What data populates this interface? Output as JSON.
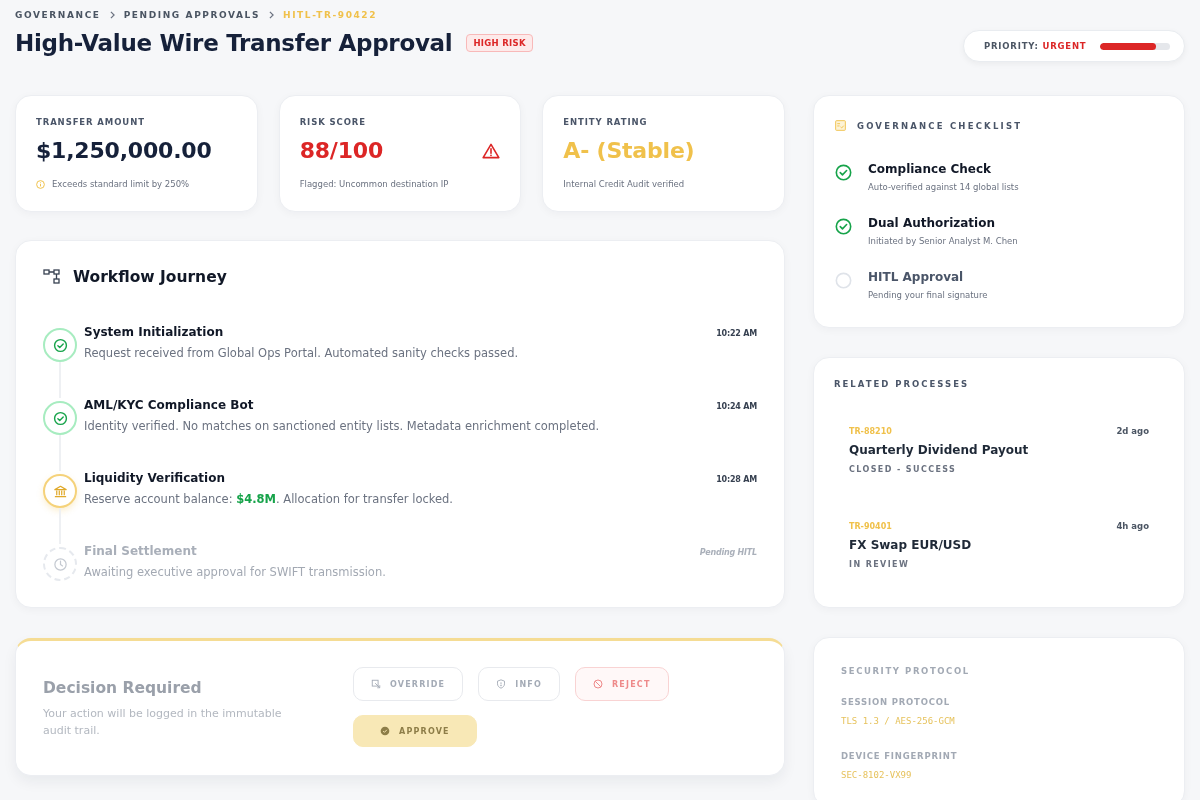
{
  "breadcrumbs": [
    {
      "label": "GOVERNANCE",
      "current": false
    },
    {
      "label": "PENDING APPROVALS",
      "current": false
    },
    {
      "label": "HITL-TR-90422",
      "current": true
    }
  ],
  "title": "High-Value Wire Transfer Approval",
  "risk_badge": "HIGH RISK",
  "priority": {
    "label": "PRIORITY:",
    "value": "URGENT",
    "level": 0.8
  },
  "metrics": [
    {
      "kind": "amount",
      "label": "TRANSFER AMOUNT",
      "value": "$1,250,000.00",
      "color": "#16213a",
      "note": "Exceeds standard limit by 250%"
    },
    {
      "kind": "risk",
      "label": "RISK SCORE",
      "value": "88/100",
      "color": "#dc2626",
      "note": "Flagged: Uncommon destination IP"
    },
    {
      "kind": "rating",
      "label": "ENTITY RATING",
      "value": "A- (Stable)",
      "color": "#f0c14b",
      "note": "Internal Credit Audit verified"
    }
  ],
  "workflow": {
    "title": "Workflow Journey",
    "steps": [
      {
        "kind": "done",
        "title": "System Initialization",
        "detail": "Request received from Global Ops Portal. Automated sanity checks passed.",
        "time": "10:22 AM"
      },
      {
        "kind": "done",
        "title": "AML/KYC Compliance Bot",
        "detail": "Identity verified. No matches on sanctioned entity lists. Metadata enrichment completed.",
        "time": "10:24 AM"
      },
      {
        "kind": "active",
        "title": "Liquidity Verification",
        "detail": "Reserve account balance: **$4.8M**. Allocation for transfer locked.",
        "time": "10:28 AM"
      },
      {
        "kind": "pending",
        "title": "Final Settlement",
        "detail": "Awaiting executive approval for SWIFT transmission.",
        "time": "Pending HITL"
      }
    ]
  },
  "decision": {
    "title": "Decision Required",
    "text": "Your action will be logged in the immutable audit trail.",
    "actions": [
      {
        "label": "OVERRIDE",
        "kind": "override"
      },
      {
        "label": "INFO",
        "kind": "info"
      },
      {
        "label": "REJECT",
        "kind": "reject"
      },
      {
        "label": "APPROVE",
        "kind": "approve"
      }
    ]
  },
  "checklist": {
    "title": "GOVERNANCE CHECKLIST",
    "items": [
      {
        "title": "Compliance Check",
        "detail": "Auto-verified against 14 global lists",
        "checked": true
      },
      {
        "title": "Dual Authorization",
        "detail": "Initiated by Senior Analyst M. Chen",
        "checked": true
      },
      {
        "title": "HITL Approval",
        "detail": "Pending your final signature",
        "checked": false
      }
    ]
  },
  "related": {
    "title": "RELATED PROCESSES",
    "items": [
      {
        "id": "TR-88210",
        "age": "2d ago",
        "title": "Quarterly Dividend Payout",
        "status": "CLOSED - SUCCESS"
      },
      {
        "id": "TR-90401",
        "age": "4h ago",
        "title": "FX Swap EUR/USD",
        "status": "IN REVIEW"
      }
    ]
  },
  "security": {
    "title": "SECURITY PROTOCOL",
    "fields": [
      {
        "label": "SESSION PROTOCOL",
        "value": "TLS 1.3 / AES-256-GCM"
      },
      {
        "label": "DEVICE FINGERPRINT",
        "value": "SEC-8102-VX99"
      }
    ]
  }
}
